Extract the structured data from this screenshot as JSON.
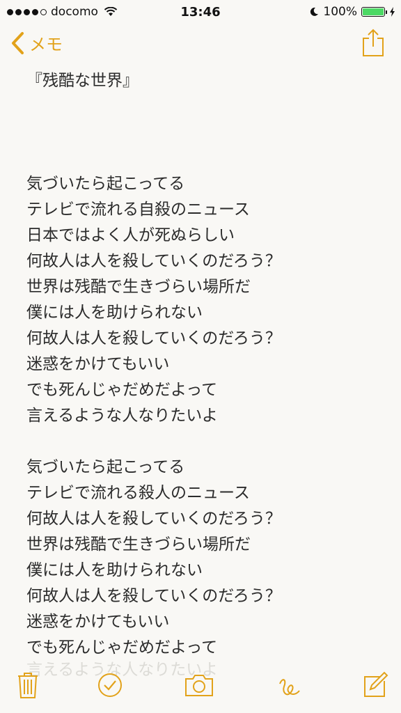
{
  "status_bar": {
    "carrier": "docomo",
    "time": "13:46",
    "battery_percent": "100%",
    "battery_level": 1.0
  },
  "nav": {
    "back_label": "メモ"
  },
  "note": {
    "title": "『残酷な世界』",
    "stanza1": [
      "気づいたら起こってる",
      "テレビで流れる自殺のニュース",
      "日本ではよく人が死ぬらしい",
      "何故人は人を殺していくのだろう？",
      "世界は残酷で生きづらい場所だ",
      "僕には人を助けられない",
      "何故人は人を殺していくのだろう？",
      "迷惑をかけてもいい",
      "でも死んじゃだめだよって",
      "言えるような人なりたいよ"
    ],
    "stanza2": [
      "気づいたら起こってる",
      "テレビで流れる殺人のニュース",
      "何故人は人を殺していくのだろう？",
      "世界は残酷で生きづらい場所だ",
      "僕には人を助けられない",
      "何故人は人を殺していくのだろう？",
      "迷惑をかけてもいい",
      "でも死んじゃだめだよって"
    ],
    "faded_line": "言えるような人なりたいよ"
  },
  "colors": {
    "accent": "#e2a21a",
    "text": "#2b2b2b",
    "background": "#f9f8f5",
    "battery": "#4cd964"
  },
  "toolbar_icons": [
    "trash-icon",
    "checklist-icon",
    "camera-icon",
    "sketch-icon",
    "compose-icon"
  ]
}
